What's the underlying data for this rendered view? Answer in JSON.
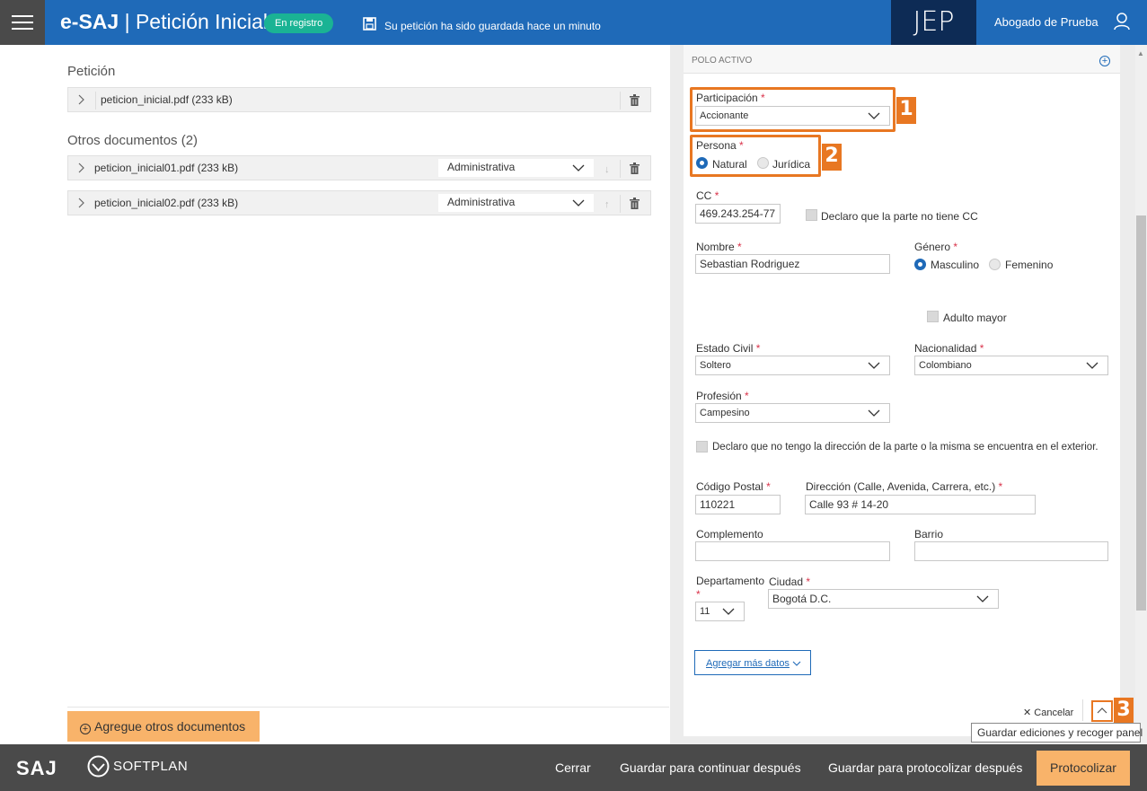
{
  "header": {
    "brand": "e-SAJ",
    "separator": "|",
    "title": "Petición Inicial",
    "status_badge": "En registro",
    "save_message": "Su petición ha sido guardada hace un minuto",
    "org": "JEP",
    "user_name": "Abogado de Prueba"
  },
  "left": {
    "peticion_title": "Petición",
    "peticion_file": "peticion_inicial.pdf (233 kB)",
    "otros_title": "Otros documentos (2)",
    "otros_docs": [
      {
        "file": "peticion_inicial01.pdf (233 kB)",
        "type": "Administrativa"
      },
      {
        "file": "peticion_inicial02.pdf (233 kB)",
        "type": "Administrativa"
      }
    ],
    "add_docs_label": "Agregue otros documentos"
  },
  "panel": {
    "title": "POLO ACTIVO",
    "participacion_label": "Participación",
    "participacion_value": "Accionante",
    "persona_label": "Persona",
    "persona_options": [
      "Natural",
      "Jurídica"
    ],
    "cc_label": "CC",
    "cc_value": "469.243.254-77",
    "no_cc_label": "Declaro que la parte no tiene CC",
    "nombre_label": "Nombre",
    "nombre_value": "Sebastian Rodriguez",
    "genero_label": "Género",
    "genero_options": [
      "Masculino",
      "Femenino"
    ],
    "adulto_mayor_label": "Adulto mayor",
    "estado_civil_label": "Estado Civil",
    "estado_civil_value": "Soltero",
    "nacionalidad_label": "Nacionalidad",
    "nacionalidad_value": "Colombiano",
    "profesion_label": "Profesión",
    "profesion_value": "Campesino",
    "no_direccion_label": "Declaro que no tengo la dirección de la parte o la misma se encuentra en el exterior.",
    "codigo_postal_label": "Código Postal",
    "codigo_postal_value": "110221",
    "direccion_label": "Dirección (Calle, Avenida, Carrera, etc.)",
    "direccion_value": "Calle 93 # 14-20",
    "complemento_label": "Complemento",
    "barrio_label": "Barrio",
    "departamento_label": "Departamento",
    "departamento_value": "11",
    "ciudad_label": "Ciudad",
    "ciudad_value": "Bogotá D.C.",
    "more_data_label": "Agregar más datos",
    "cancel_label": "Cancelar",
    "tooltip": "Guardar ediciones y recoger panel",
    "required_mark": "*",
    "callouts": [
      "1",
      "2",
      "3"
    ]
  },
  "footer": {
    "saj": "SAJ",
    "softplan": "SOFTPLAN",
    "cerrar": "Cerrar",
    "guardar_continuar": "Guardar para continuar después",
    "guardar_protocolizar": "Guardar para protocolizar después",
    "protocolizar": "Protocolizar"
  },
  "colors": {
    "header_blue": "#1f6ab8",
    "badge_green": "#1ab394",
    "callout_orange": "#e87722",
    "button_orange": "#f8b36a",
    "footer_gray": "#4a4a4a"
  }
}
